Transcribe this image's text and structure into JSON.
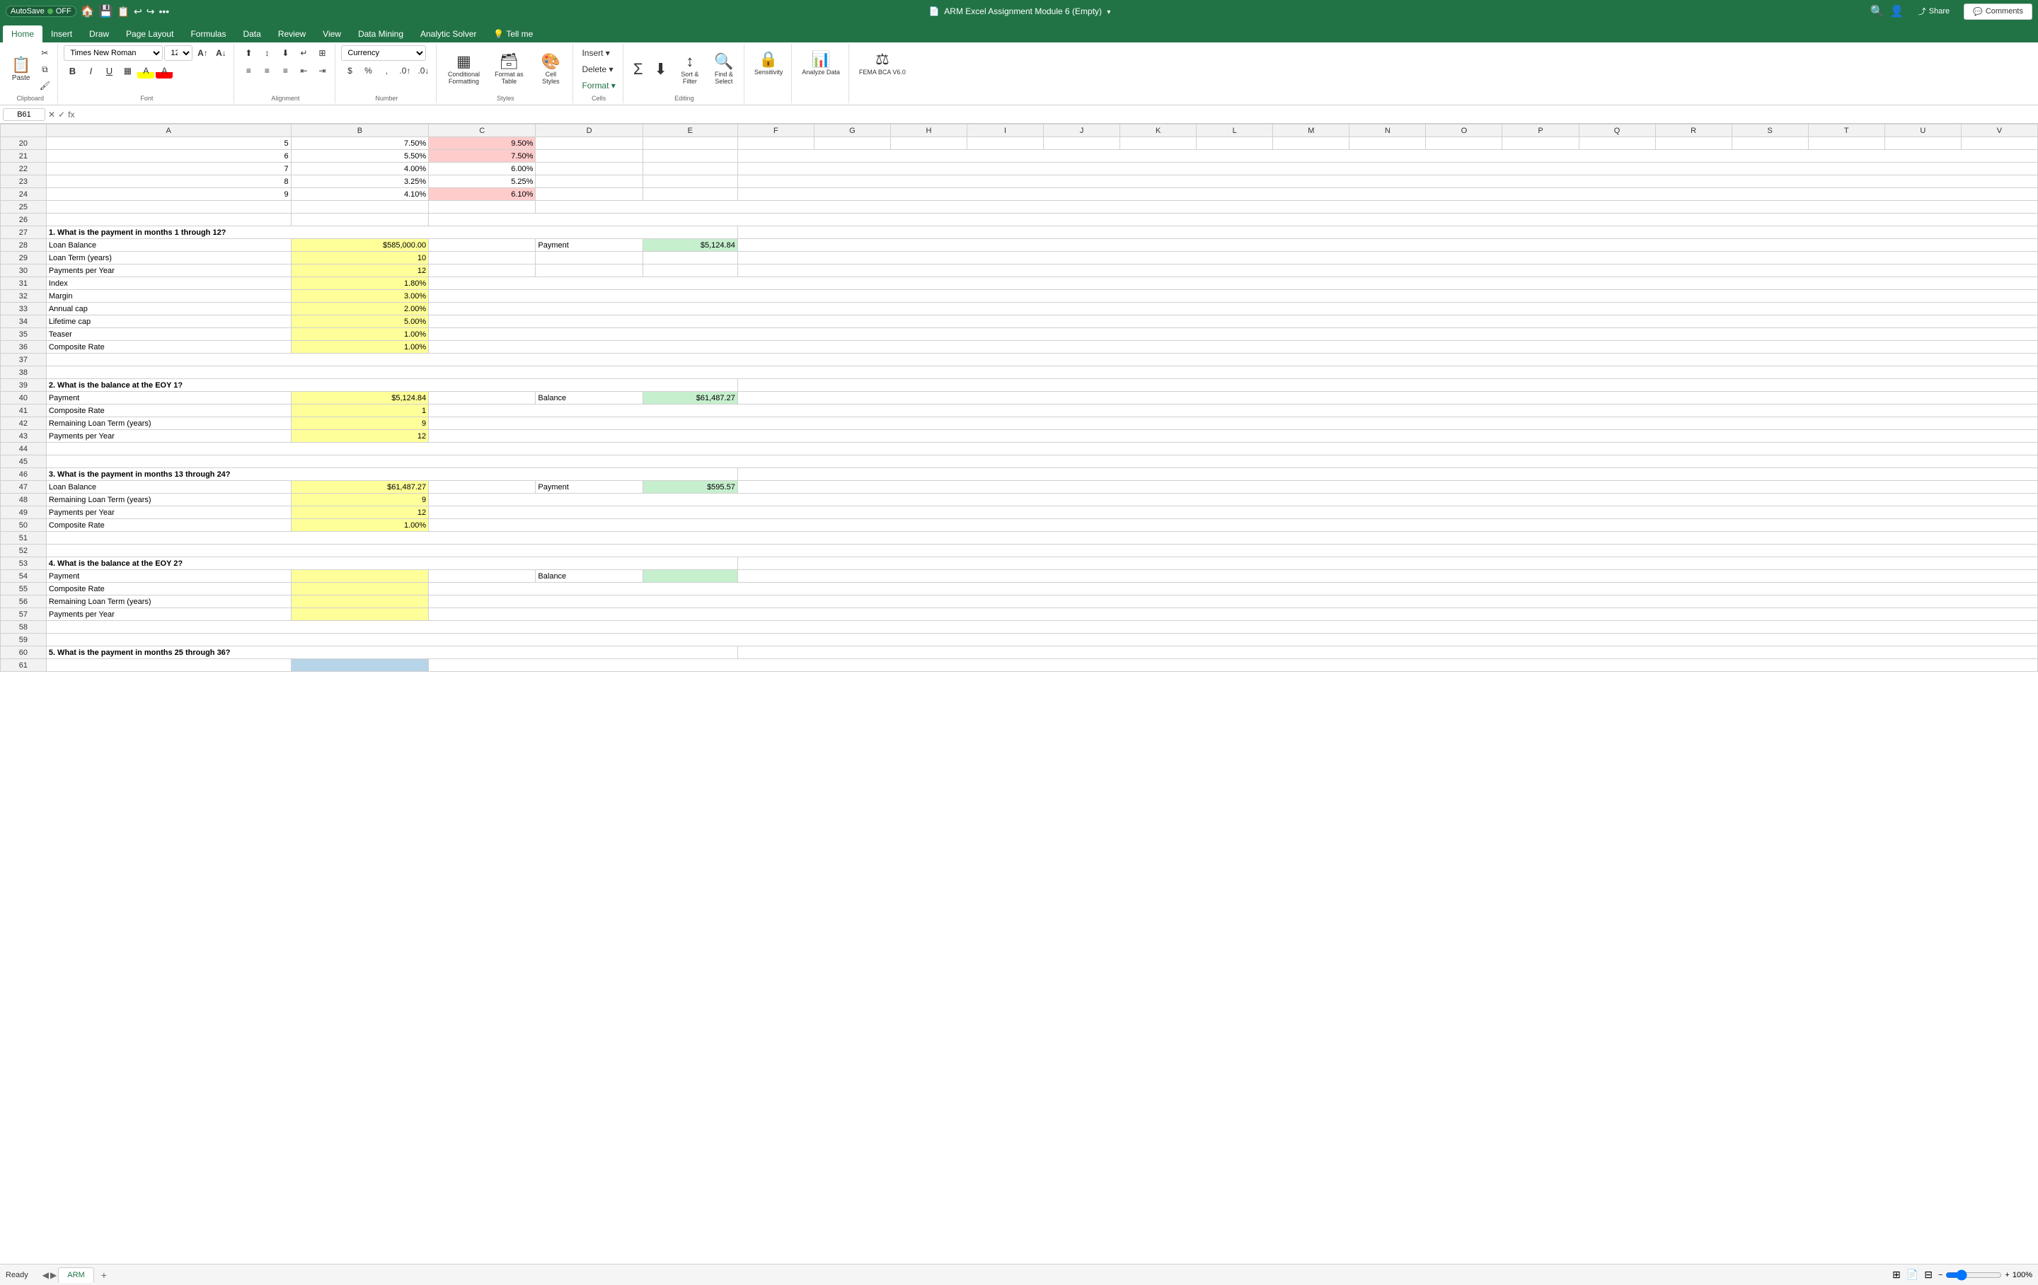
{
  "titleBar": {
    "autosave": "AutoSave",
    "autosaveState": "OFF",
    "title": "ARM Excel Assignment Module 6 (Empty)",
    "shareLabel": "Share",
    "commentsLabel": "Comments"
  },
  "ribbonTabs": [
    {
      "label": "Home",
      "active": true
    },
    {
      "label": "Insert",
      "active": false
    },
    {
      "label": "Draw",
      "active": false
    },
    {
      "label": "Page Layout",
      "active": false
    },
    {
      "label": "Formulas",
      "active": false
    },
    {
      "label": "Data",
      "active": false
    },
    {
      "label": "Review",
      "active": false
    },
    {
      "label": "View",
      "active": false
    },
    {
      "label": "Data Mining",
      "active": false
    },
    {
      "label": "Analytic Solver",
      "active": false
    },
    {
      "label": "Tell me",
      "active": false
    }
  ],
  "ribbon": {
    "fontFamily": "Times New Roman",
    "fontSize": "12",
    "numberFormat": "Currency",
    "bold": "B",
    "italic": "I",
    "underline": "U",
    "paste": "Paste",
    "clipboard": "Clipboard",
    "font": "Font",
    "alignment": "Alignment",
    "number": "Number",
    "styles": "Styles",
    "cells": "Cells",
    "editing": "Editing",
    "sensitivity": "Sensitivity",
    "conditionalFormatting": "Conditional Formatting",
    "formatAsTable": "Format as Table",
    "cellStyles": "Cell Styles",
    "insert": "Insert",
    "delete": "Delete",
    "format": "Format",
    "sortFilter": "Sort & Filter",
    "findSelect": "Find & Select",
    "analyzeData": "Analyze Data",
    "femaBca": "FEMA BCA V6.0"
  },
  "formulaBar": {
    "cellRef": "B61",
    "formula": ""
  },
  "spreadsheet": {
    "columns": [
      "A",
      "B",
      "C",
      "D",
      "E",
      "F",
      "G",
      "H",
      "I",
      "J",
      "K",
      "L",
      "M",
      "N",
      "O",
      "P",
      "Q",
      "R",
      "S",
      "T",
      "U",
      "V"
    ],
    "rows": [
      {
        "num": 20,
        "a": "5",
        "b": "7.50%",
        "c": "9.50%",
        "b_color": "",
        "c_color": "pink"
      },
      {
        "num": 21,
        "a": "6",
        "b": "5.50%",
        "c": "7.50%",
        "b_color": "",
        "c_color": "pink"
      },
      {
        "num": 22,
        "a": "7",
        "b": "4.00%",
        "c": "6.00%",
        "b_color": "",
        "c_color": ""
      },
      {
        "num": 23,
        "a": "8",
        "b": "3.25%",
        "c": "5.25%",
        "b_color": "",
        "c_color": ""
      },
      {
        "num": 24,
        "a": "9",
        "b": "4.10%",
        "c": "6.10%",
        "b_color": "",
        "c_color": "pink"
      },
      {
        "num": 25,
        "a": "",
        "b": "",
        "c": ""
      },
      {
        "num": 26,
        "a": "",
        "b": "",
        "c": ""
      },
      {
        "num": 27,
        "a": "1.  What is the payment in months 1 through 12?",
        "b": "",
        "c": "",
        "bold": true
      },
      {
        "num": 28,
        "a": "Loan Balance",
        "b": "$585,000.00",
        "c": "",
        "d": "Payment",
        "e": "$5,124.84",
        "b_color": "yellow",
        "e_color": "green"
      },
      {
        "num": 29,
        "a": "Loan Term (years)",
        "b": "10",
        "b_color": "yellow"
      },
      {
        "num": 30,
        "a": "Payments per Year",
        "b": "12",
        "b_color": "yellow"
      },
      {
        "num": 31,
        "a": "Index",
        "b": "1.80%",
        "b_color": "yellow"
      },
      {
        "num": 32,
        "a": "Margin",
        "b": "3.00%",
        "b_color": "yellow"
      },
      {
        "num": 33,
        "a": "Annual cap",
        "b": "2.00%",
        "b_color": "yellow"
      },
      {
        "num": 34,
        "a": "Lifetime cap",
        "b": "5.00%",
        "b_color": "yellow"
      },
      {
        "num": 35,
        "a": "Teaser",
        "b": "1.00%",
        "b_color": "yellow"
      },
      {
        "num": 36,
        "a": "Composite Rate",
        "b": "1.00%",
        "b_color": "yellow"
      },
      {
        "num": 37,
        "a": "",
        "b": ""
      },
      {
        "num": 38,
        "a": "",
        "b": ""
      },
      {
        "num": 39,
        "a": "2.  What is the balance at the EOY 1?",
        "b": "",
        "bold": true
      },
      {
        "num": 40,
        "a": "Payment",
        "b": "$5,124.84",
        "d": "Balance",
        "e": "$61,487.27",
        "b_color": "yellow",
        "e_color": "green"
      },
      {
        "num": 41,
        "a": "Composite Rate",
        "b": "1",
        "b_color": "yellow"
      },
      {
        "num": 42,
        "a": "Remaining Loan Term (years)",
        "b": "9",
        "b_color": "yellow"
      },
      {
        "num": 43,
        "a": "Payments per Year",
        "b": "12",
        "b_color": "yellow"
      },
      {
        "num": 44,
        "a": "",
        "b": ""
      },
      {
        "num": 45,
        "a": "",
        "b": ""
      },
      {
        "num": 46,
        "a": "3.  What is the payment in months 13 through 24?",
        "b": "",
        "bold": true
      },
      {
        "num": 47,
        "a": "Loan Balance",
        "b": "$61,487.27",
        "d": "Payment",
        "e": "$595.57",
        "b_color": "yellow",
        "e_color": "green"
      },
      {
        "num": 48,
        "a": "Remaining Loan Term (years)",
        "b": "9",
        "b_color": "yellow"
      },
      {
        "num": 49,
        "a": "Payments per Year",
        "b": "12",
        "b_color": "yellow"
      },
      {
        "num": 50,
        "a": "Composite Rate",
        "b": "1.00%",
        "b_color": "yellow"
      },
      {
        "num": 51,
        "a": "",
        "b": ""
      },
      {
        "num": 52,
        "a": "",
        "b": ""
      },
      {
        "num": 53,
        "a": "4.  What is the balance at the EOY 2?",
        "b": "",
        "bold": true
      },
      {
        "num": 54,
        "a": "Payment",
        "b": "",
        "d": "Balance",
        "e": "",
        "b_color": "yellow",
        "e_color": "green_empty"
      },
      {
        "num": 55,
        "a": "Composite Rate",
        "b": "",
        "b_color": "yellow"
      },
      {
        "num": 56,
        "a": "Remaining Loan Term (years)",
        "b": "",
        "b_color": "yellow"
      },
      {
        "num": 57,
        "a": "Payments per Year",
        "b": "",
        "b_color": "yellow"
      },
      {
        "num": 58,
        "a": "",
        "b": ""
      },
      {
        "num": 59,
        "a": "",
        "b": ""
      },
      {
        "num": 60,
        "a": "5.  What is the payment in months 25 through 36?",
        "b": "",
        "bold": true
      },
      {
        "num": 61,
        "a": "",
        "b": ""
      }
    ]
  },
  "statusBar": {
    "ready": "Ready",
    "zoom": "100%"
  },
  "sheets": [
    {
      "label": "ARM",
      "active": true
    }
  ]
}
